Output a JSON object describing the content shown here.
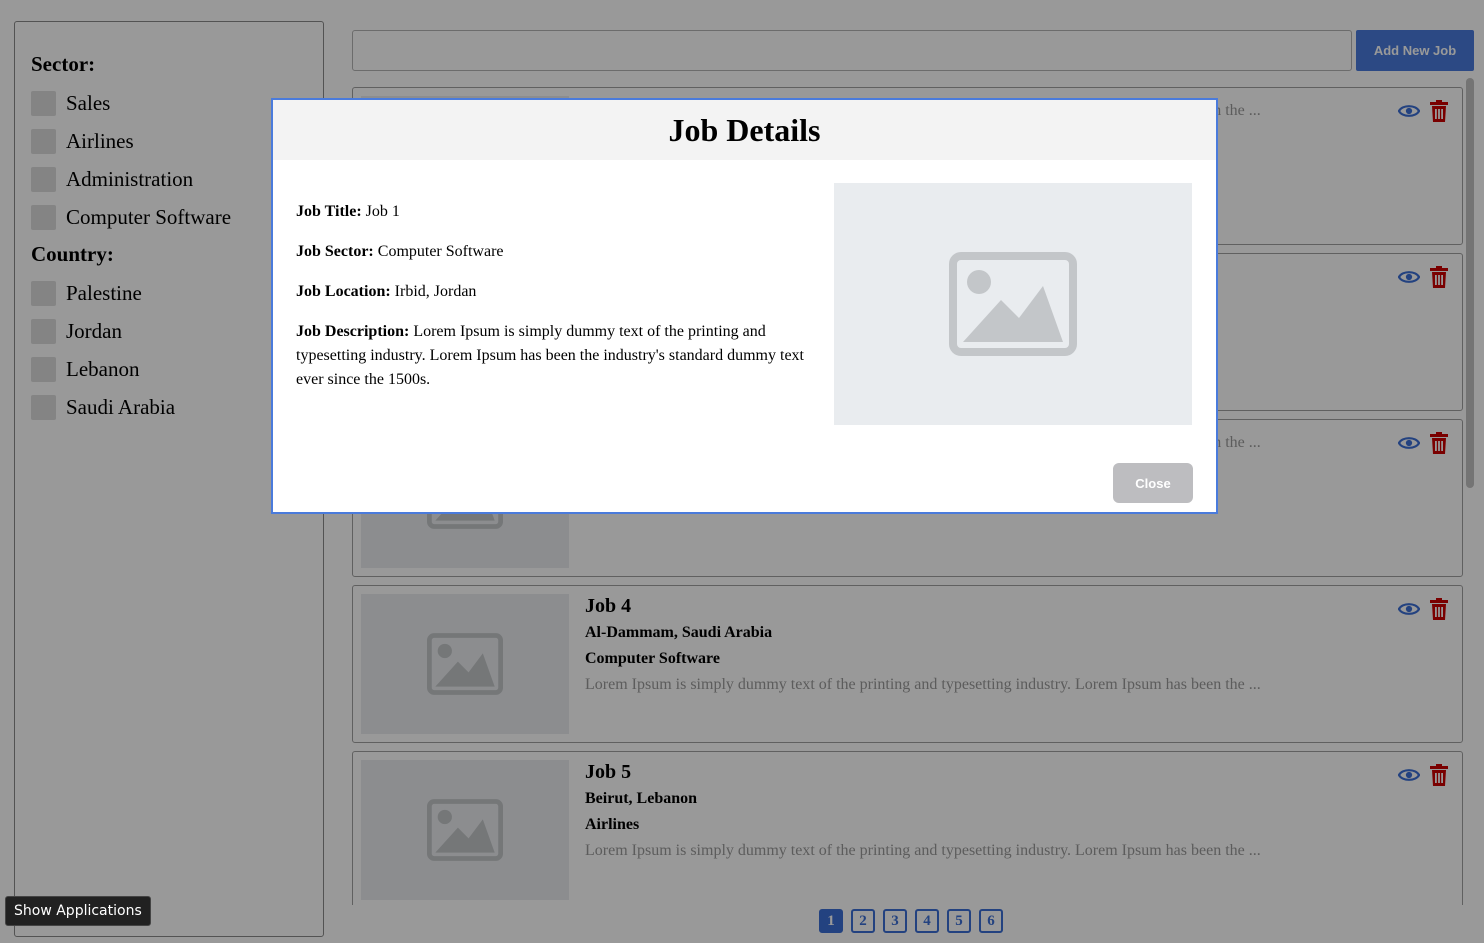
{
  "sidebar": {
    "sector_title": "Sector:",
    "sectors": [
      {
        "label": "Sales"
      },
      {
        "label": "Airlines"
      },
      {
        "label": "Administration"
      },
      {
        "label": "Computer Software"
      }
    ],
    "country_title": "Country:",
    "countries": [
      {
        "label": "Palestine"
      },
      {
        "label": "Jordan"
      },
      {
        "label": "Lebanon"
      },
      {
        "label": "Saudi Arabia"
      }
    ]
  },
  "search": {
    "value": "",
    "placeholder": ""
  },
  "toolbar": {
    "add_job_label": "Add New Job"
  },
  "jobs": [
    {
      "title": "",
      "location": "",
      "sector": "",
      "description": "Lorem Ipsum is simply dummy text of the printing and typesetting industry. Lorem Ipsum has been the ..."
    },
    {
      "title": "",
      "location": "",
      "sector": "",
      "description": ""
    },
    {
      "title": "",
      "location": "",
      "sector": "",
      "description": "Lorem Ipsum is simply dummy text of the printing and typesetting industry. Lorem Ipsum has been the ..."
    },
    {
      "title": "Job 4",
      "location": "Al-Dammam, Saudi Arabia",
      "sector": "Computer Software",
      "description": "Lorem Ipsum is simply dummy text of the printing and typesetting industry. Lorem Ipsum has been the ..."
    },
    {
      "title": "Job 5",
      "location": "Beirut, Lebanon",
      "sector": "Airlines",
      "description": "Lorem Ipsum is simply dummy text of the printing and typesetting industry. Lorem Ipsum has been the ..."
    }
  ],
  "pagination": {
    "pages": [
      "1",
      "2",
      "3",
      "4",
      "5",
      "6"
    ],
    "current": "1"
  },
  "show_applications_label": "Show Applications",
  "modal": {
    "title": "Job Details",
    "fields": [
      {
        "label": "Job Title:",
        "value": "Job 1"
      },
      {
        "label": "Job Sector:",
        "value": "Computer Software"
      },
      {
        "label": "Job Location:",
        "value": "Irbid, Jordan"
      },
      {
        "label": "Job Description:",
        "value": "Lorem Ipsum is simply dummy text of the printing and typesetting industry. Lorem Ipsum has been the industry's standard dummy text ever since the 1500s."
      }
    ],
    "close_label": "Close"
  },
  "colors": {
    "primary": "#4a7bdc",
    "danger": "#cc0000",
    "close_button": "#bdbdc0",
    "placeholder_bg": "#e9ecef",
    "placeholder_icon": "#c3c6c9"
  },
  "icons": {
    "view": "eye-icon",
    "delete": "trash-icon",
    "thumbnail": "image-placeholder-icon"
  }
}
